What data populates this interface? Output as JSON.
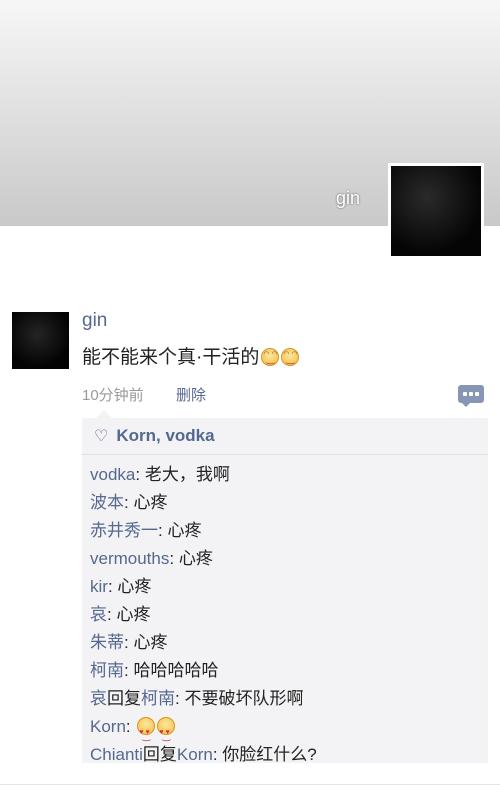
{
  "profile": {
    "cover_name": "gin"
  },
  "post": {
    "author": "gin",
    "text": "能不能来个真·干活的",
    "time": "10分钟前",
    "delete_label": "删除",
    "likes": "Korn, vodka",
    "comments": [
      {
        "author": "vodka",
        "reply_to": "",
        "text": "老大，我啊"
      },
      {
        "author": "波本",
        "reply_to": "",
        "text": "心疼"
      },
      {
        "author": "赤井秀一",
        "reply_to": "",
        "text": "心疼"
      },
      {
        "author": "vermouths",
        "reply_to": "",
        "text": "心疼"
      },
      {
        "author": "kir",
        "reply_to": "",
        "text": "心疼"
      },
      {
        "author": "哀",
        "reply_to": "",
        "text": "心疼"
      },
      {
        "author": "朱蒂",
        "reply_to": "",
        "text": "心疼"
      },
      {
        "author": "柯南",
        "reply_to": "",
        "text": "哈哈哈哈哈"
      },
      {
        "author": "哀",
        "reply_to": "柯南",
        "text": "不要破坏队形啊"
      },
      {
        "author": "Korn",
        "reply_to": "",
        "text": ""
      },
      {
        "author": "Chianti",
        "reply_to": "Korn",
        "text": "你脸红什么?"
      }
    ],
    "reply_word": "回复",
    "icons": [
      "heart-icon",
      "comment-icon",
      "smile-emoji",
      "heart-eyes-emoji"
    ]
  }
}
